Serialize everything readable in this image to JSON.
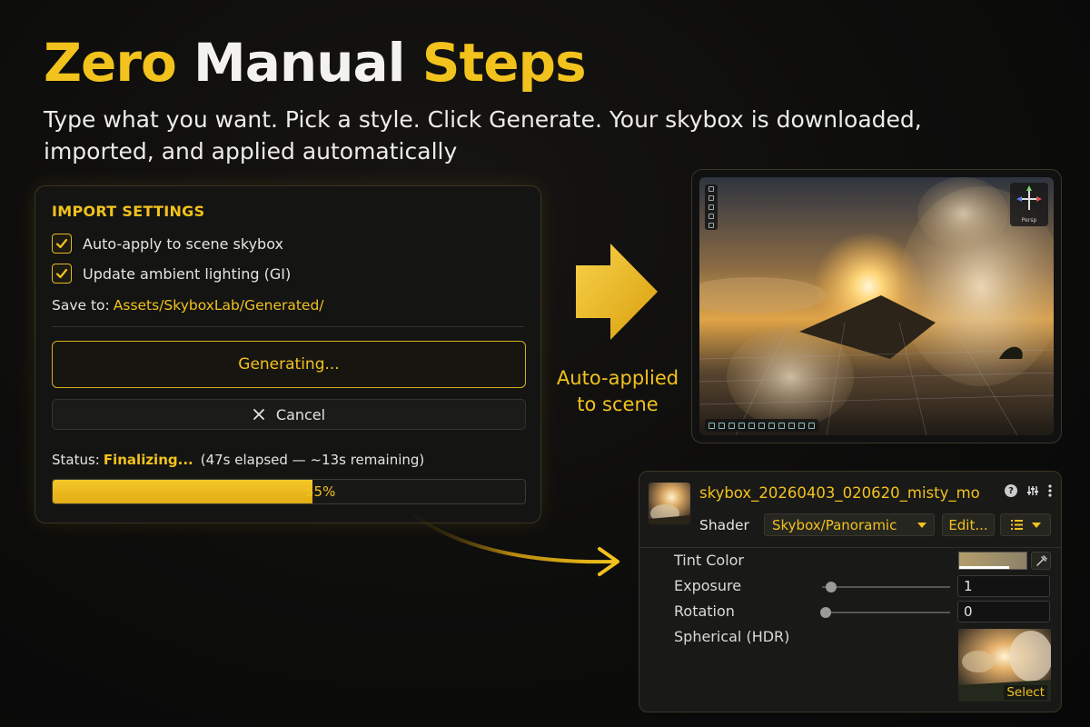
{
  "hero": {
    "title_part1": "Zero",
    "title_part2": "Manual",
    "title_part3": "Steps",
    "subtitle": "Type what you want. Pick a style. Click Generate. Your skybox is downloaded, imported, and applied automatically"
  },
  "import_panel": {
    "heading": "IMPORT SETTINGS",
    "options": [
      {
        "label": "Auto-apply to scene skybox",
        "checked": true
      },
      {
        "label": "Update ambient lighting (GI)",
        "checked": true
      }
    ],
    "save_label": "Save to:",
    "save_path": "Assets/SkyboxLab/Generated/",
    "generate_label": "Generating...",
    "cancel_label": "Cancel",
    "status_label": "Status:",
    "status_value": "Finalizing...",
    "status_detail": "(47s elapsed — ~13s remaining)",
    "progress_fraction": 0.55,
    "progress_text": "55%"
  },
  "flow": {
    "caption_line1": "Auto-applied",
    "caption_line2": "to scene"
  },
  "viewport": {
    "gizmo_label": "Persp"
  },
  "inspector": {
    "material_name": "skybox_20260403_020620_misty_mo",
    "shader_label": "Shader",
    "shader_value": "Skybox/Panoramic",
    "edit_label": "Edit...",
    "properties": {
      "tint_label": "Tint Color",
      "exposure_label": "Exposure",
      "exposure_value": "1",
      "rotation_label": "Rotation",
      "rotation_value": "0",
      "spherical_label": "Spherical (HDR)"
    },
    "select_label": "Select"
  },
  "colors": {
    "accent": "#f2c21d",
    "background": "#0c0c0b",
    "panel": "#141413"
  },
  "icons": [
    "check-icon",
    "close-icon",
    "arrow-right-icon",
    "curved-arrow-icon",
    "help-icon",
    "sliders-icon",
    "more-icon",
    "chevron-down-icon",
    "list-icon",
    "eyedropper-icon"
  ]
}
